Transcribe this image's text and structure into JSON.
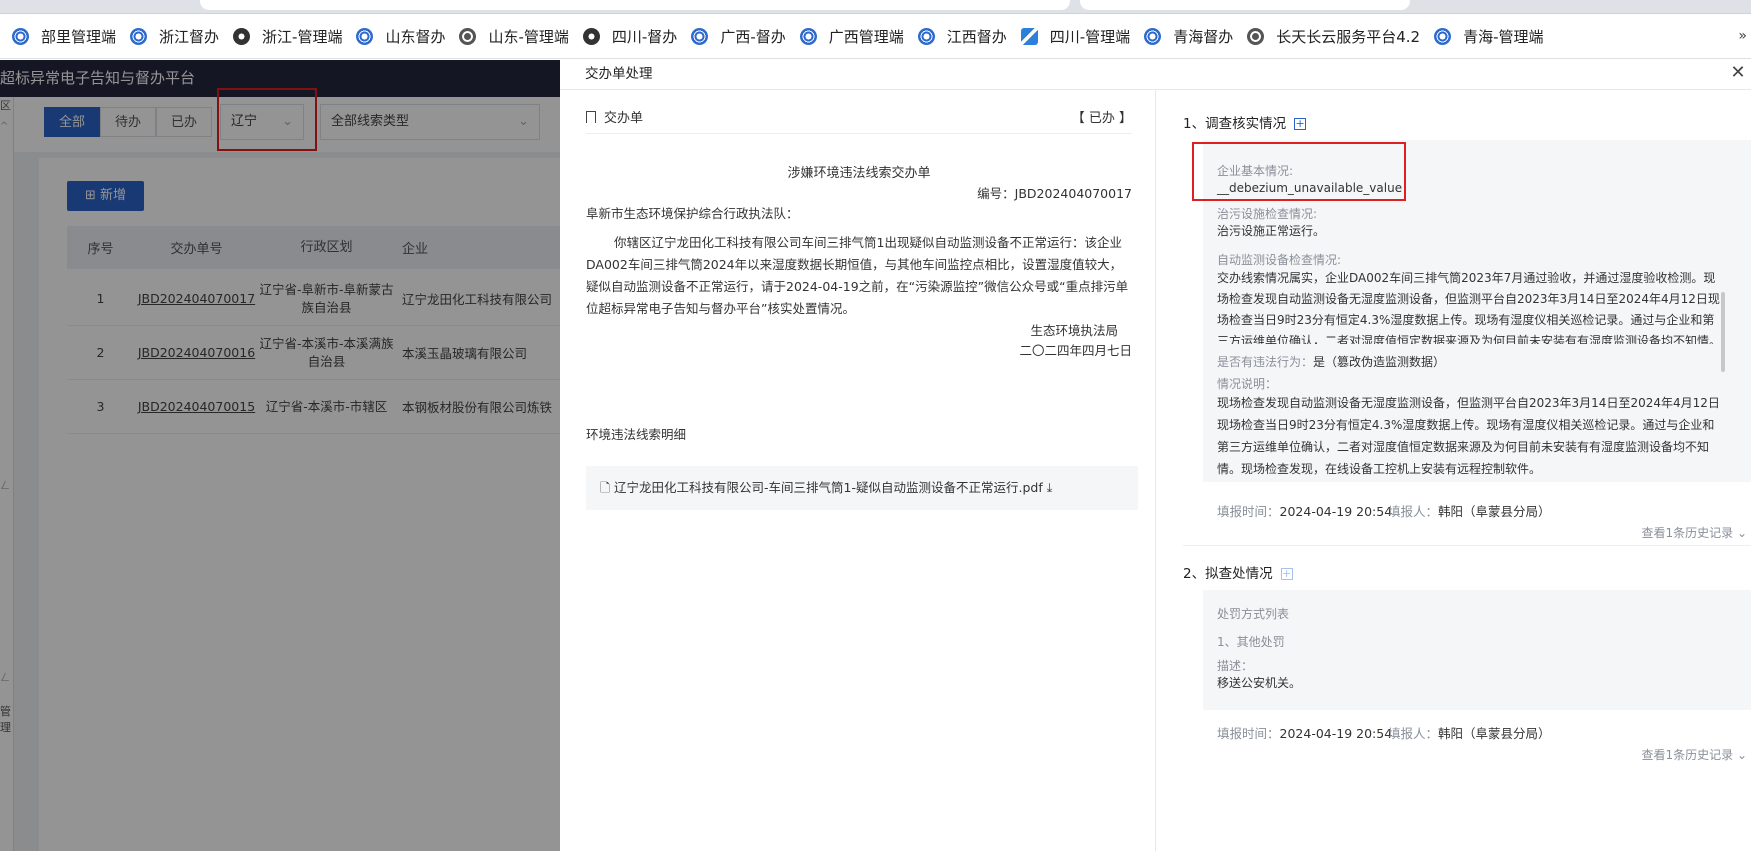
{
  "bookmarks": [
    {
      "label": "部里管理端",
      "icon": "gov-emblem-icon"
    },
    {
      "label": "浙江督办",
      "icon": "gov-emblem-icon"
    },
    {
      "label": "浙江-管理端",
      "icon": "dark-emblem-icon"
    },
    {
      "label": "山东督办",
      "icon": "gov-emblem-icon"
    },
    {
      "label": "山东-管理端",
      "icon": "globe-icon"
    },
    {
      "label": "四川-督办",
      "icon": "dark-emblem-icon"
    },
    {
      "label": "广西-督办",
      "icon": "gov-emblem-icon"
    },
    {
      "label": "广西管理端",
      "icon": "gov-emblem-icon"
    },
    {
      "label": "江西督办",
      "icon": "gov-emblem-icon"
    },
    {
      "label": "四川-管理端",
      "icon": "feather-icon"
    },
    {
      "label": "青海督办",
      "icon": "gov-emblem-icon"
    },
    {
      "label": "长天长云服务平台4.2",
      "icon": "globe-icon"
    },
    {
      "label": "青海-管理端",
      "icon": "gov-emblem-icon"
    }
  ],
  "bookmarks_more": "»",
  "app": {
    "title": "超标异常电子告知与督办平台",
    "filters": {
      "all": "全部",
      "pending": "待办",
      "done": "已办"
    },
    "province_select": "辽宁",
    "clue_type_select": "全部线索类型",
    "add_button": "新增",
    "table": {
      "headers": [
        "序号",
        "交办单号",
        "行政区划",
        "企业"
      ],
      "rows": [
        {
          "no": "1",
          "id": "JBD202404070017",
          "region": "辽宁省-阜新市-阜新蒙古族自治县",
          "company": "辽宁龙田化工科技有限公司"
        },
        {
          "no": "2",
          "id": "JBD202404070016",
          "region": "辽宁省-本溪市-本溪满族自治县",
          "company": "本溪玉晶玻璃有限公司"
        },
        {
          "no": "3",
          "id": "JBD202404070015",
          "region": "辽宁省-本溪市-市辖区",
          "company": "本钢板材股份有限公司炼铁"
        }
      ]
    },
    "side_marks": [
      "区",
      "^",
      "ㄥ",
      "ㄥ",
      "管理"
    ]
  },
  "drawer": {
    "title": "交办单处理",
    "close": "✕",
    "doc": {
      "header": "交办单",
      "status": "【 已办 】",
      "title": "涉嫌环境违法线索交办单",
      "number": "编号：JBD202404070017",
      "addressee": "阜新市生态环境保护综合行政执法队：",
      "body": "你辖区辽宁龙田化工科技有限公司车间三排气筒1出现疑似自动监测设备不正常运行：该企业DA002车间三排气筒2024年以来湿度数据长期恒值，与其他车间监控点相比，设置湿度值较大，疑似自动监测设备不正常运行，请于2024-04-19之前，在“污染源监控”微信公众号或“重点排污单位超标异常电子告知与督办平台”核实处置情况。",
      "signer": "生态环境执法局",
      "date": "二〇二四年四月七日",
      "detail_title": "环境违法线索明细",
      "attachment": "辽宁龙田化工科技有限公司-车间三排气筒1-疑似自动监测设备不正常运行.pdf"
    },
    "survey": {
      "title": "1、调查核实情况",
      "basic_label": "企业基本情况:",
      "basic_value": "__debezium_unavailable_value",
      "facility_label": "治污设施检查情况:",
      "facility_value": "治污设施正常运行。",
      "monitor_label": "自动监测设备检查情况:",
      "monitor_value": "交办线索情况属实，企业DA002车间三排气筒2023年7月通过验收，并通过湿度验收检测。现场检查发现自动监测设备无湿度监测设备，但监测平台自2023年3月14日至2024年4月12日现场检查当日9时23分有恒定4.3%湿度数据上传。现场有湿度仪相关巡检记录。通过与企业和第三方运维单位确认，二者对湿度值恒定数据来源及为何目前未安装有有湿度监测设备均不知情。",
      "violation_label": "是否有违法行为：",
      "violation_value": "是（篡改伪造监测数据）",
      "explain_label": "情况说明：",
      "explain_value": "现场检查发现自动监测设备无湿度监测设备，但监测平台自2023年3月14日至2024年4月12日现场检查当日9时23分有恒定4.3%湿度数据上传。现场有湿度仪相关巡检记录。通过与企业和第三方运维单位确认，二者对湿度值恒定数据来源及为何目前未安装有有湿度监测设备均不知情。现场检查发现，在线设备工控机上安装有远程控制软件。",
      "fill_time_label": "填报时间：",
      "fill_time": "2024-04-19 20:54",
      "filler_label": "填报人：",
      "filler": "韩阳（阜蒙县分局）",
      "history": "查看1条历史记录"
    },
    "proposal": {
      "title": "2、拟查处情况",
      "list_label": "处罚方式列表",
      "item": "1、其他处罚",
      "desc_label": "描述：",
      "desc_value": "移送公安机关。",
      "fill_time_label": "填报时间：",
      "fill_time": "2024-04-19 20:54",
      "filler_label": "填报人：",
      "filler": "韩阳（阜蒙县分局）",
      "history": "查看1条历史记录"
    }
  }
}
